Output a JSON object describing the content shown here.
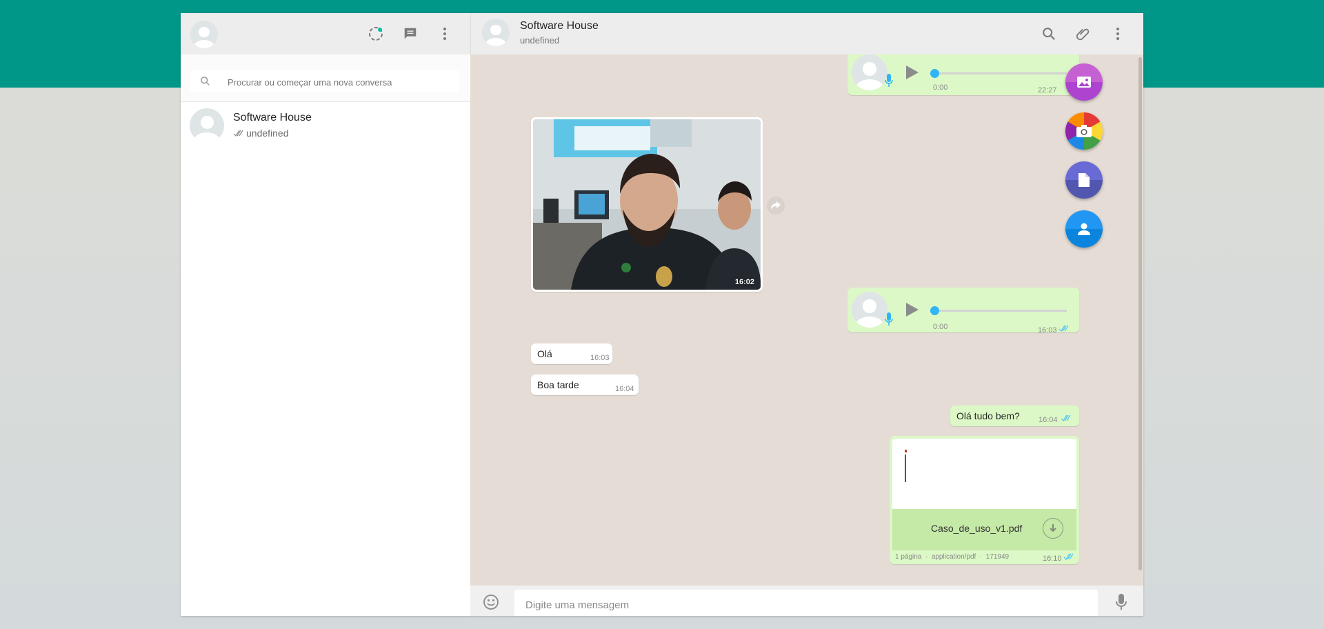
{
  "left_header": {
    "avatar": "profile-avatar",
    "icons": [
      "status-icon",
      "new-chat-icon",
      "menu-icon"
    ]
  },
  "search": {
    "placeholder": "Procurar ou começar uma nova conversa"
  },
  "chats": [
    {
      "name": "Software House",
      "status": "undefined"
    }
  ],
  "conversation": {
    "name": "Software House",
    "status": "undefined",
    "header_icons": [
      "search-icon",
      "attach-icon",
      "menu-icon"
    ]
  },
  "messages": {
    "audio1": {
      "duration": "0:00",
      "time": "22:27"
    },
    "image1": {
      "time": "16:02"
    },
    "audio2": {
      "duration": "0:00",
      "time": "16:03"
    },
    "text1": {
      "text": "Olá",
      "time": "16:03"
    },
    "text2": {
      "text": "Boa tarde",
      "time": "16:04"
    },
    "text3": {
      "text": "Olá tudo bem?",
      "time": "16:04"
    },
    "doc1": {
      "filename": "Caso_de_uso_v1.pdf",
      "meta": "1 página  ·  application/pdf  ·  171949",
      "time": "16:10"
    }
  },
  "attach_menu": [
    "gallery",
    "camera",
    "document",
    "contact"
  ],
  "composer": {
    "placeholder": "Digite uma mensagem"
  },
  "colors": {
    "teal": "#009688",
    "outgoing": "#dcf8c6",
    "incoming": "#ffffff",
    "accent_blue": "#30b6f6"
  }
}
